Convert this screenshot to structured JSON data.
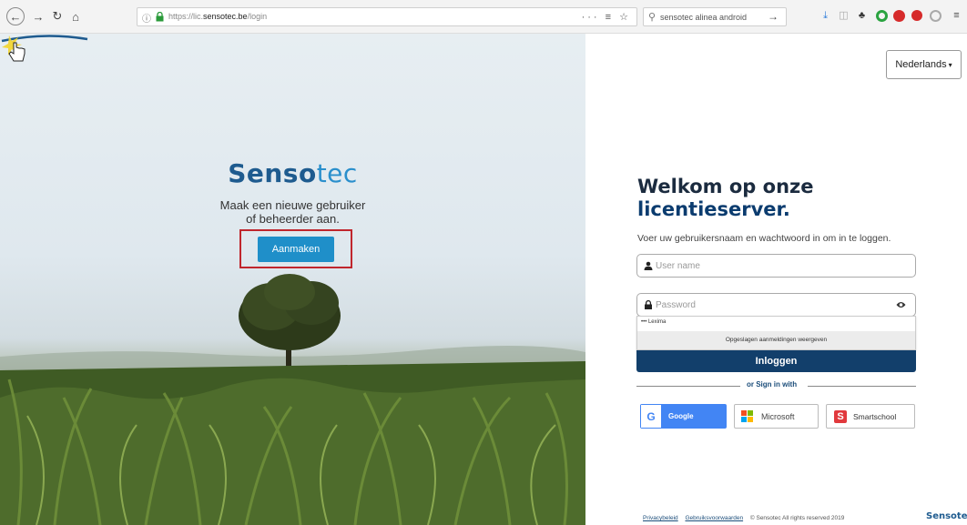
{
  "browser": {
    "url_prefix": "https://lic.",
    "url_domain": "sensotec.be",
    "url_path": "/login",
    "search_text": "sensotec alinea android",
    "url_actions": "··· ≡ ☆"
  },
  "hero": {
    "brand_main": "Senso",
    "brand_accent": "tec",
    "tagline_line1": "Maak een nieuwe gebruiker",
    "tagline_line2": "of beheerder aan.",
    "create_button": "Aanmaken"
  },
  "language": {
    "selected": "Nederlands"
  },
  "login": {
    "welcome_line1": "Welkom op onze",
    "welcome_line2": "licentieserver.",
    "intro": "Voer uw gebruikersnaam en wachtwoord in om in te loggen.",
    "username_placeholder": "User name",
    "password_placeholder": "Password",
    "autofill_item": "••• Lexima",
    "autofill_footer": "Opgeslagen aanmeldingen weergeven",
    "login_button": "Inloggen",
    "or_sign_in": "or Sign in with",
    "google": "Google",
    "microsoft": "Microsoft",
    "smartschool": "Smartschool"
  },
  "footer": {
    "privacy": "Privacybeleid",
    "terms": "Gebruiksvoorwaarden",
    "copyright": "© Sensotec All rights reserved 2019",
    "logo": "Sensotec"
  },
  "colors": {
    "brand_dark": "#1e5b8f",
    "brand_light": "#2a8fcc",
    "login_button": "#123f6b",
    "highlight": "#c0262d"
  }
}
